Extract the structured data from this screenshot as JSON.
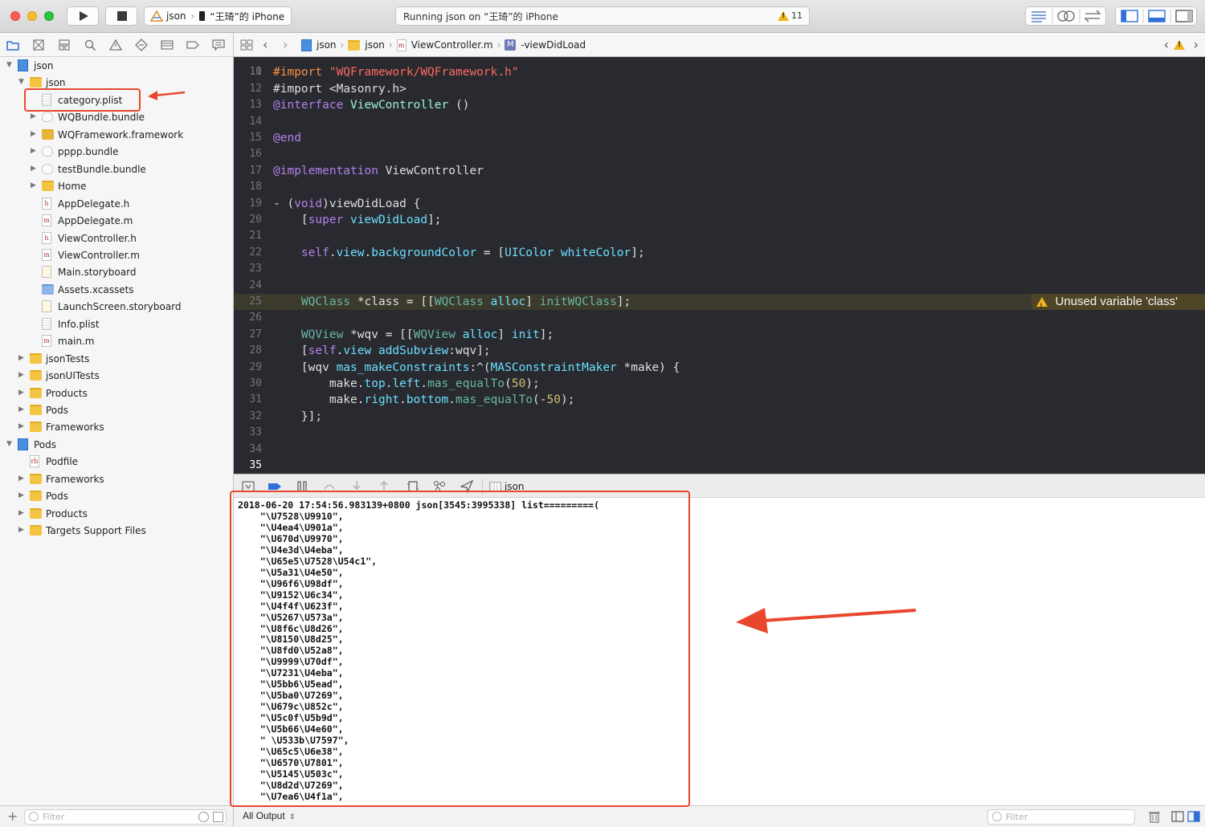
{
  "toolbar": {
    "scheme_target": "json",
    "scheme_device": "“王琦”的 iPhone",
    "activity_text": "Running json on “王琦”的 iPhone",
    "warning_count": "11",
    "warning_color": "#f0b41c"
  },
  "navigator": {
    "filter_placeholder": "Filter",
    "items": [
      {
        "label": "json",
        "icon": "project-icon",
        "indent": 0,
        "disclosure": "open"
      },
      {
        "label": "json",
        "icon": "folder-icon",
        "indent": 1,
        "disclosure": "open"
      },
      {
        "label": "category.plist",
        "icon": "plist-file-icon",
        "indent": 2,
        "disclosure": ""
      },
      {
        "label": "WQBundle.bundle",
        "icon": "bundle-icon",
        "indent": 2,
        "disclosure": "closed"
      },
      {
        "label": "WQFramework.framework",
        "icon": "framework-icon",
        "indent": 2,
        "disclosure": "closed"
      },
      {
        "label": "pppp.bundle",
        "icon": "bundle-icon",
        "indent": 2,
        "disclosure": "closed"
      },
      {
        "label": "testBundle.bundle",
        "icon": "bundle-icon",
        "indent": 2,
        "disclosure": "closed"
      },
      {
        "label": "Home",
        "icon": "folder-icon",
        "indent": 2,
        "disclosure": "closed"
      },
      {
        "label": "AppDelegate.h",
        "icon": "header-file-icon",
        "indent": 2,
        "disclosure": ""
      },
      {
        "label": "AppDelegate.m",
        "icon": "source-file-icon",
        "indent": 2,
        "disclosure": ""
      },
      {
        "label": "ViewController.h",
        "icon": "header-file-icon",
        "indent": 2,
        "disclosure": ""
      },
      {
        "label": "ViewController.m",
        "icon": "source-file-icon",
        "indent": 2,
        "disclosure": ""
      },
      {
        "label": "Main.storyboard",
        "icon": "storyboard-icon",
        "indent": 2,
        "disclosure": ""
      },
      {
        "label": "Assets.xcassets",
        "icon": "assets-icon",
        "indent": 2,
        "disclosure": ""
      },
      {
        "label": "LaunchScreen.storyboard",
        "icon": "storyboard-icon",
        "indent": 2,
        "disclosure": ""
      },
      {
        "label": "Info.plist",
        "icon": "plist-file-icon",
        "indent": 2,
        "disclosure": ""
      },
      {
        "label": "main.m",
        "icon": "source-file-icon",
        "indent": 2,
        "disclosure": ""
      },
      {
        "label": "jsonTests",
        "icon": "folder-icon",
        "indent": 1,
        "disclosure": "closed"
      },
      {
        "label": "jsonUITests",
        "icon": "folder-icon",
        "indent": 1,
        "disclosure": "closed"
      },
      {
        "label": "Products",
        "icon": "folder-icon",
        "indent": 1,
        "disclosure": "closed"
      },
      {
        "label": "Pods",
        "icon": "folder-icon",
        "indent": 1,
        "disclosure": "closed"
      },
      {
        "label": "Frameworks",
        "icon": "folder-icon",
        "indent": 1,
        "disclosure": "closed"
      },
      {
        "label": "Pods",
        "icon": "project-icon",
        "indent": 0,
        "disclosure": "open"
      },
      {
        "label": "Podfile",
        "icon": "ruby-file-icon",
        "indent": 1,
        "disclosure": ""
      },
      {
        "label": "Frameworks",
        "icon": "folder-icon",
        "indent": 1,
        "disclosure": "closed"
      },
      {
        "label": "Pods",
        "icon": "folder-icon",
        "indent": 1,
        "disclosure": "closed"
      },
      {
        "label": "Products",
        "icon": "folder-icon",
        "indent": 1,
        "disclosure": "closed"
      },
      {
        "label": "Targets Support Files",
        "icon": "folder-icon",
        "indent": 1,
        "disclosure": "closed"
      }
    ]
  },
  "jumpbar": {
    "crumbs": [
      "json",
      "json",
      "ViewController.m",
      "-viewDidLoad"
    ],
    "method_badge": "M",
    "file_badge": "m"
  },
  "editor": {
    "partial_top_line": "#import <Masonry.h>",
    "partial_top_number": "10",
    "lines": [
      {
        "n": "11",
        "seg": [
          [
            "pp",
            "#import "
          ],
          [
            "str",
            "\"WQFramework/WQFramework.h\""
          ]
        ]
      },
      {
        "n": "12",
        "seg": []
      },
      {
        "n": "13",
        "seg": [
          [
            "dec",
            "@interface "
          ],
          [
            "cls",
            "ViewController"
          ],
          [
            "plain",
            " ()"
          ]
        ]
      },
      {
        "n": "14",
        "seg": []
      },
      {
        "n": "15",
        "seg": [
          [
            "dec",
            "@end"
          ]
        ]
      },
      {
        "n": "16",
        "seg": []
      },
      {
        "n": "17",
        "seg": [
          [
            "dec",
            "@implementation "
          ],
          [
            "plain",
            "ViewController"
          ]
        ]
      },
      {
        "n": "18",
        "seg": []
      },
      {
        "n": "19",
        "seg": [
          [
            "plain",
            "- ("
          ],
          [
            "kw",
            "void"
          ],
          [
            "plain",
            ")viewDidLoad {"
          ]
        ]
      },
      {
        "n": "20",
        "seg": [
          [
            "plain",
            "    ["
          ],
          [
            "kw",
            "super"
          ],
          [
            "plain",
            " "
          ],
          [
            "api",
            "viewDidLoad"
          ],
          [
            "plain",
            "];"
          ]
        ]
      },
      {
        "n": "21",
        "seg": []
      },
      {
        "n": "22",
        "seg": [
          [
            "plain",
            "    "
          ],
          [
            "kw",
            "self"
          ],
          [
            "plain",
            "."
          ],
          [
            "api",
            "view"
          ],
          [
            "plain",
            "."
          ],
          [
            "api",
            "backgroundColor"
          ],
          [
            "plain",
            " = ["
          ],
          [
            "api",
            "UIColor"
          ],
          [
            "plain",
            " "
          ],
          [
            "api",
            "whiteColor"
          ],
          [
            "plain",
            "];"
          ]
        ]
      },
      {
        "n": "23",
        "seg": []
      },
      {
        "n": "24",
        "seg": []
      },
      {
        "n": "25",
        "seg": [
          [
            "plain",
            "    "
          ],
          [
            "mth",
            "WQClass"
          ],
          [
            "plain",
            " *class = [["
          ],
          [
            "mth",
            "WQClass"
          ],
          [
            "plain",
            " "
          ],
          [
            "api",
            "alloc"
          ],
          [
            "plain",
            "] "
          ],
          [
            "mth",
            "initWQClass"
          ],
          [
            "plain",
            "];"
          ]
        ],
        "highlight": true
      },
      {
        "n": "26",
        "seg": []
      },
      {
        "n": "27",
        "seg": [
          [
            "plain",
            "    "
          ],
          [
            "mth",
            "WQView"
          ],
          [
            "plain",
            " *wqv = [["
          ],
          [
            "mth",
            "WQView"
          ],
          [
            "plain",
            " "
          ],
          [
            "api",
            "alloc"
          ],
          [
            "plain",
            "] "
          ],
          [
            "api",
            "init"
          ],
          [
            "plain",
            "];"
          ]
        ]
      },
      {
        "n": "28",
        "seg": [
          [
            "plain",
            "    ["
          ],
          [
            "kw",
            "self"
          ],
          [
            "plain",
            "."
          ],
          [
            "api",
            "view"
          ],
          [
            "plain",
            " "
          ],
          [
            "api",
            "addSubview"
          ],
          [
            "plain",
            ":wqv];"
          ]
        ]
      },
      {
        "n": "29",
        "seg": [
          [
            "plain",
            "    [wqv "
          ],
          [
            "api",
            "mas_makeConstraints"
          ],
          [
            "plain",
            ":^("
          ],
          [
            "api",
            "MASConstraintMaker"
          ],
          [
            "plain",
            " *make) {"
          ]
        ]
      },
      {
        "n": "30",
        "seg": [
          [
            "plain",
            "        make."
          ],
          [
            "api",
            "top"
          ],
          [
            "plain",
            "."
          ],
          [
            "api",
            "left"
          ],
          [
            "plain",
            "."
          ],
          [
            "mth",
            "mas_equalTo"
          ],
          [
            "plain",
            "("
          ],
          [
            "num",
            "50"
          ],
          [
            "plain",
            ");"
          ]
        ]
      },
      {
        "n": "31",
        "seg": [
          [
            "plain",
            "        make."
          ],
          [
            "api",
            "right"
          ],
          [
            "plain",
            "."
          ],
          [
            "api",
            "bottom"
          ],
          [
            "plain",
            "."
          ],
          [
            "mth",
            "mas_equalTo"
          ],
          [
            "plain",
            "(-"
          ],
          [
            "num",
            "50"
          ],
          [
            "plain",
            ");"
          ]
        ]
      },
      {
        "n": "32",
        "seg": [
          [
            "plain",
            "    }];"
          ]
        ]
      },
      {
        "n": "33",
        "seg": []
      },
      {
        "n": "34",
        "seg": []
      },
      {
        "n": "35",
        "seg": []
      }
    ],
    "warning_message": "Unused variable 'class'"
  },
  "debugbar": {
    "target_label": "json"
  },
  "console": {
    "header": "2018-06-20 17:54:56.983139+0800 json[3545:3995338] list=========(",
    "entries": [
      "    \"\\U7528\\U9910\",",
      "    \"\\U4ea4\\U901a\",",
      "    \"\\U670d\\U9970\",",
      "    \"\\U4e3d\\U4eba\",",
      "    \"\\U65e5\\U7528\\U54c1\",",
      "    \"\\U5a31\\U4e50\",",
      "    \"\\U96f6\\U98df\",",
      "    \"\\U9152\\U6c34\",",
      "    \"\\U4f4f\\U623f\",",
      "    \"\\U5267\\U573a\",",
      "    \"\\U8f6c\\U8d26\",",
      "    \"\\U8150\\U8d25\",",
      "    \"\\U8fd0\\U52a8\",",
      "    \"\\U9999\\U70df\",",
      "    \"\\U7231\\U4eba\",",
      "    \"\\U5bb6\\U5ead\",",
      "    \"\\U5ba0\\U7269\",",
      "    \"\\U679c\\U852c\",",
      "    \"\\U5c0f\\U5b9d\",",
      "    \"\\U5b66\\U4e60\",",
      "    \" \\U533b\\U7597\",",
      "    \"\\U65c5\\U6e38\",",
      "    \"\\U6570\\U7801\",",
      "    \"\\U5145\\U503c\",",
      "    \"\\U8d2d\\U7269\",",
      "    \"\\U7ea6\\U4f1a\","
    ],
    "output_selector": "All Output",
    "filter_placeholder": "Filter"
  },
  "annotation_color": "#e8472e"
}
